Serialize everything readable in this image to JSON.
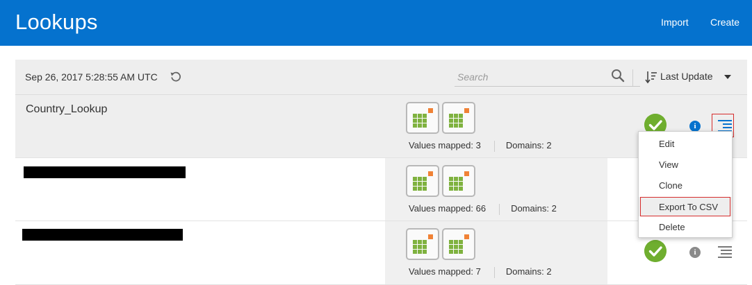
{
  "header": {
    "title": "Lookups",
    "import_label": "Import",
    "create_label": "Create",
    "background": "#0572ce"
  },
  "toolbar": {
    "timestamp": "Sep 26, 2017 5:28:55 AM UTC",
    "refresh_icon": "refresh-icon",
    "search": {
      "placeholder": "Search",
      "value": ""
    },
    "sort_label": "Last Update",
    "sort_icon": "sort-descending-icon"
  },
  "rows": [
    {
      "name": "Country_Lookup",
      "values_mapped": "Values mapped: 3",
      "domains": "Domains: 2",
      "info_color": "#0572ce",
      "menu_color": "#0572ce"
    },
    {
      "name": "",
      "values_mapped": "Values mapped: 66",
      "domains": "Domains: 2"
    },
    {
      "name": "",
      "values_mapped": "Values mapped: 7",
      "domains": "Domains: 2",
      "info_color": "#8a8a8a",
      "menu_color": "#777777"
    }
  ],
  "menu": {
    "items": [
      "Edit",
      "View",
      "Clone",
      "Export To CSV",
      "Delete"
    ],
    "highlighted": "Export To CSV"
  },
  "colors": {
    "accent": "#0572ce",
    "success": "#6fae2f",
    "highlight_border": "#d62b2b",
    "tile_green": "#7fb23f",
    "tile_orange": "#f08236"
  }
}
